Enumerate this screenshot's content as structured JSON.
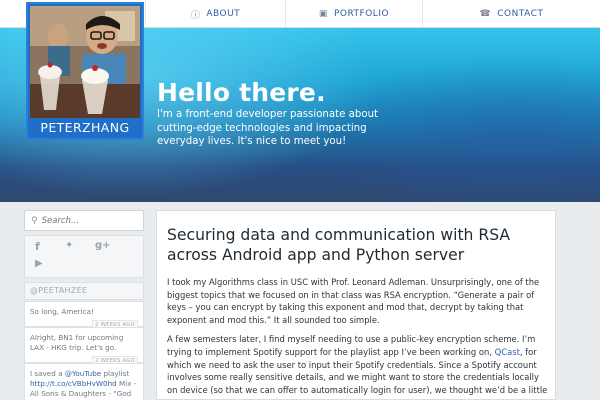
{
  "nav": {
    "about": {
      "label": "ABOUT",
      "icon": "info-circle-icon"
    },
    "portfolio": {
      "label": "PORTFOLIO",
      "icon": "briefcase-icon"
    },
    "contact": {
      "label": "CONTACT",
      "icon": "phone-icon"
    }
  },
  "profile": {
    "name": "PETERZHANG"
  },
  "hero": {
    "greeting": "Hello there.",
    "intro": "I'm a front-end developer passionate about cutting-edge technologies and impacting everyday lives. It's nice to meet you!"
  },
  "sidebar": {
    "search_placeholder": "Search...",
    "social": [
      "facebook-icon",
      "twitter-icon",
      "google-plus-icon",
      "youtube-icon"
    ],
    "twitter_handle": "@PEETAHZEE",
    "tweets": [
      {
        "text": "So long, America!",
        "time": "2 WEEKS AGO"
      },
      {
        "text": "Alright, BN1 for upcoming LAX - HKG trip. Let's go.",
        "time": "2 WEEKS AGO"
      },
      {
        "text_pre": "I saved a ",
        "link1": "@YouTube",
        "text_mid": " playlist ",
        "link2": "http://t.co/cVBbHvW0hd",
        "text_post": " Mix - All Sons & Daughters - \"God With"
      }
    ]
  },
  "post": {
    "title": "Securing data and communication with RSA across Android app and Python server",
    "p1": "I took my Algorithms class in USC with Prof. Leonard Adleman. Unsurprisingly, one of the biggest topics that we focused on in that class was RSA encryption. “Generate a pair of keys – you can encrypt by taking this exponent and mod that, decrypt by taking that exponent and mod this.” It all sounded too simple.",
    "p2_pre": "A few semesters later, I find myself needing to use a public-key encryption scheme. I’m trying to implement Spotify support for the playlist app I’ve been working on, ",
    "p2_link": "QCast",
    "p2_post": ", for which we need to ask the user to input their Spotify credentials. Since a Spotify account involves some really sensitive details, and we might want to store the credentials locally on device (so that we can offer to automatically login for user), we thought we’d be a little"
  }
}
